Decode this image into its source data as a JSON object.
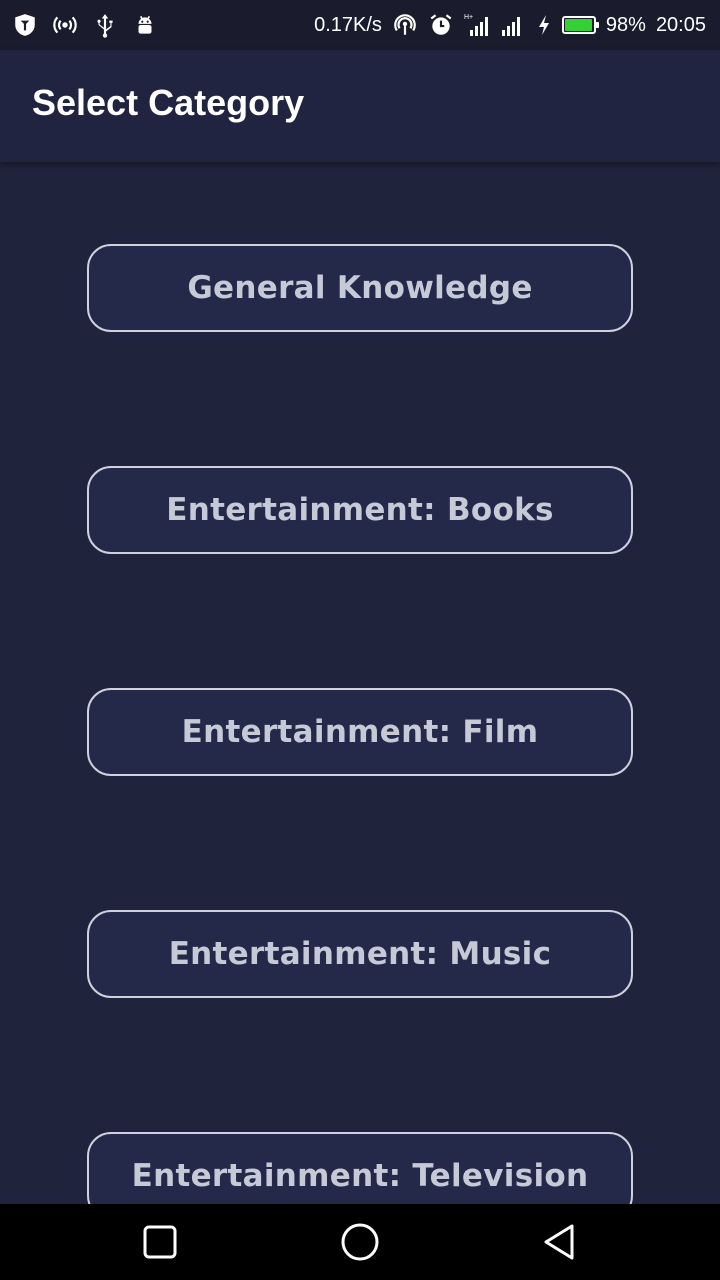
{
  "status_bar": {
    "left_icons": [
      "shield-app-icon",
      "hotspot-icon",
      "usb-icon",
      "android-debug-icon"
    ],
    "network_speed": "0.17K/s",
    "right_icons": [
      "nfc-icon",
      "alarm-icon",
      "signal-h-plus-icon",
      "signal-icon",
      "charging-icon"
    ],
    "network_type": "H+",
    "battery_percent": "98%",
    "battery_level": 0.98,
    "time": "20:05",
    "battery_color": "#35d035"
  },
  "app_bar": {
    "title": "Select Category"
  },
  "categories": [
    {
      "label": "General Knowledge"
    },
    {
      "label": "Entertainment: Books"
    },
    {
      "label": "Entertainment: Film"
    },
    {
      "label": "Entertainment: Music"
    },
    {
      "label": "Entertainment: Television"
    }
  ],
  "nav_bar": {
    "icons": [
      "recent-apps-icon",
      "home-icon",
      "back-icon"
    ]
  },
  "colors": {
    "background": "#1f233b",
    "app_bar": "#202440",
    "button_fill": "#24294a",
    "button_border": "#cfd2de",
    "button_text": "#c6c9d6"
  }
}
